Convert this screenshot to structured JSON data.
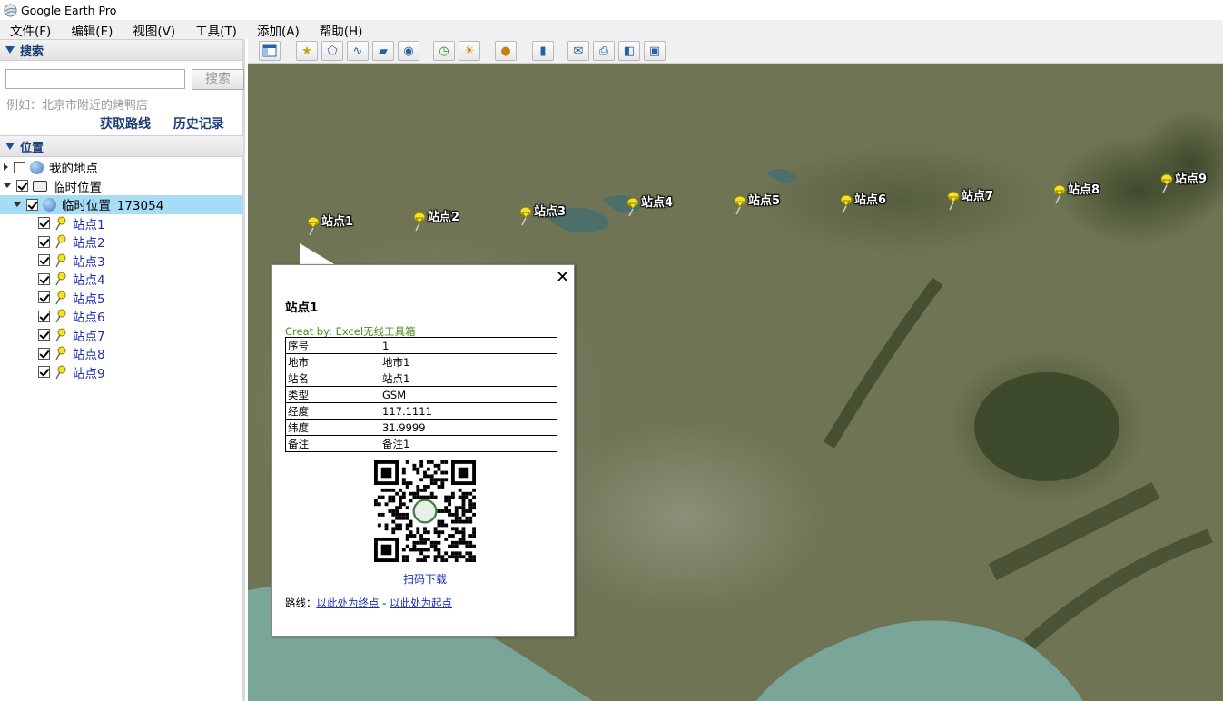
{
  "app": {
    "title": "Google Earth Pro"
  },
  "menu": [
    "文件(F)",
    "编辑(E)",
    "视图(V)",
    "工具(T)",
    "添加(A)",
    "帮助(H)"
  ],
  "search": {
    "header": "搜索",
    "input_value": "",
    "button": "搜索",
    "hint": "例如：北京市附近的烤鸭店",
    "link_directions": "获取路线",
    "link_history": "历史记录"
  },
  "places": {
    "header": "位置",
    "my_places": "我的地点",
    "temp_places": "临时位置",
    "folder": "临时位置_173054",
    "items": [
      "站点1",
      "站点2",
      "站点3",
      "站点4",
      "站点5",
      "站点6",
      "站点7",
      "站点8",
      "站点9"
    ]
  },
  "map": {
    "markers": [
      "站点1",
      "站点2",
      "站点3",
      "站点4",
      "站点5",
      "站点6",
      "站点7",
      "站点8",
      "站点9"
    ],
    "colors": {
      "land": "#6b7252",
      "water": "#7aa69a",
      "pin": "#f2e22e"
    }
  },
  "balloon": {
    "title": "站点1",
    "credit": "Creat by: Excel无线工具箱",
    "rows": [
      [
        "序号",
        "1"
      ],
      [
        "地市",
        "地市1"
      ],
      [
        "站名",
        "站点1"
      ],
      [
        "类型",
        "GSM"
      ],
      [
        "经度",
        "117.1111"
      ],
      [
        "纬度",
        "31.9999"
      ],
      [
        "备注",
        "备注1"
      ]
    ],
    "scan_label": "扫码下载",
    "route_label": "路线：",
    "route_to": "以此处为终点",
    "route_sep": " - ",
    "route_from": "以此处为起点"
  }
}
